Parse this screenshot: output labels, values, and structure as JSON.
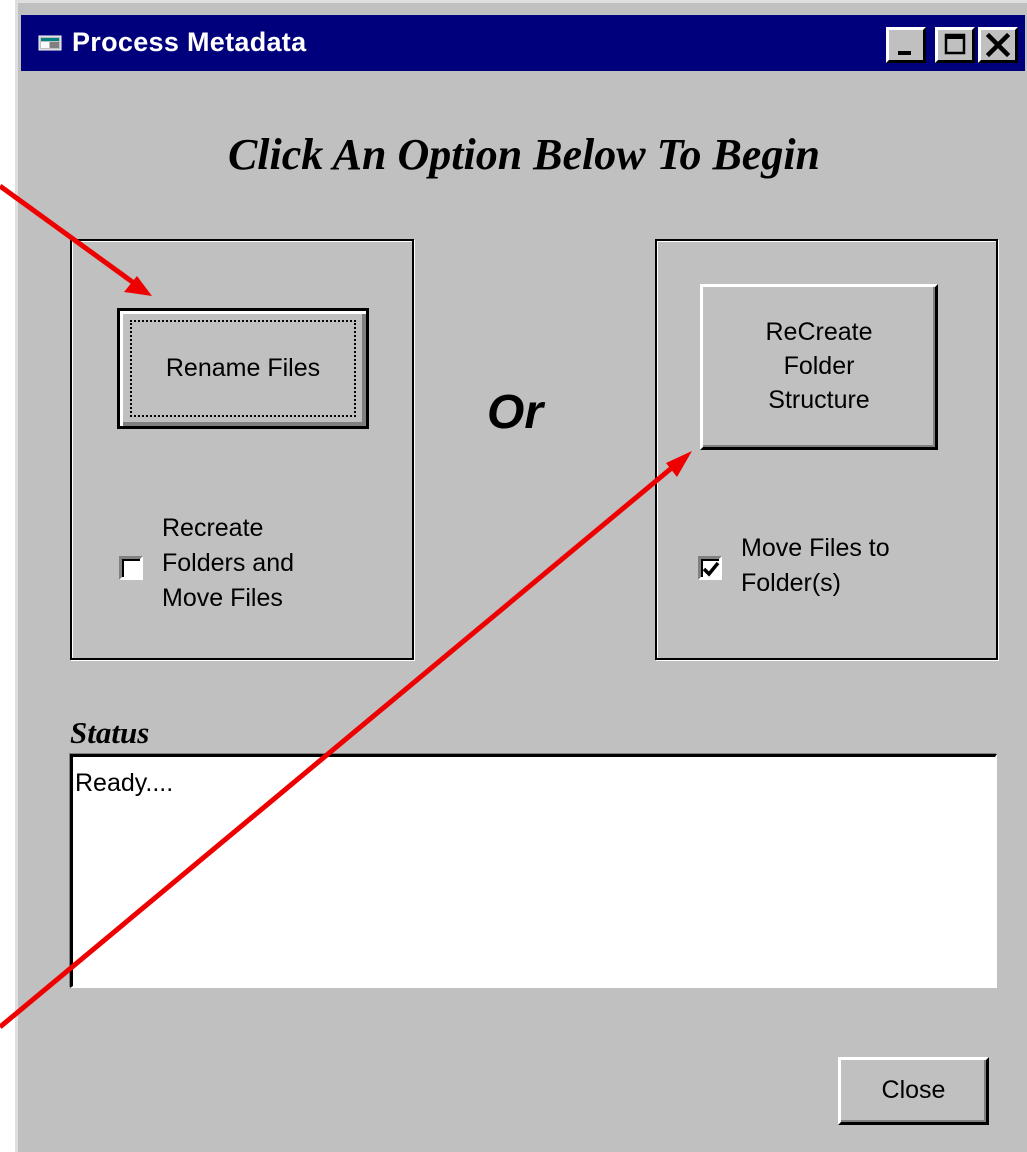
{
  "window": {
    "title": "Process Metadata",
    "title_bar_color": "#00007c",
    "face_color": "#c0c0c0",
    "controls": {
      "minimize_icon": "minimize-icon",
      "maximize_icon": "maximize-icon",
      "close_icon": "close-icon"
    }
  },
  "heading": "Click An Option Below To Begin",
  "left_panel": {
    "button_label": "Rename Files",
    "checkbox_label": "Recreate\nFolders and\nMove Files",
    "checkbox_checked": false
  },
  "separator": "Or",
  "right_panel": {
    "button_label": "ReCreate\nFolder\nStructure",
    "checkbox_label": "Move Files to\nFolder(s)",
    "checkbox_checked": true
  },
  "status": {
    "label": "Status",
    "text": "Ready...."
  },
  "close_button_label": "Close",
  "annotation_color": "#ee0000"
}
